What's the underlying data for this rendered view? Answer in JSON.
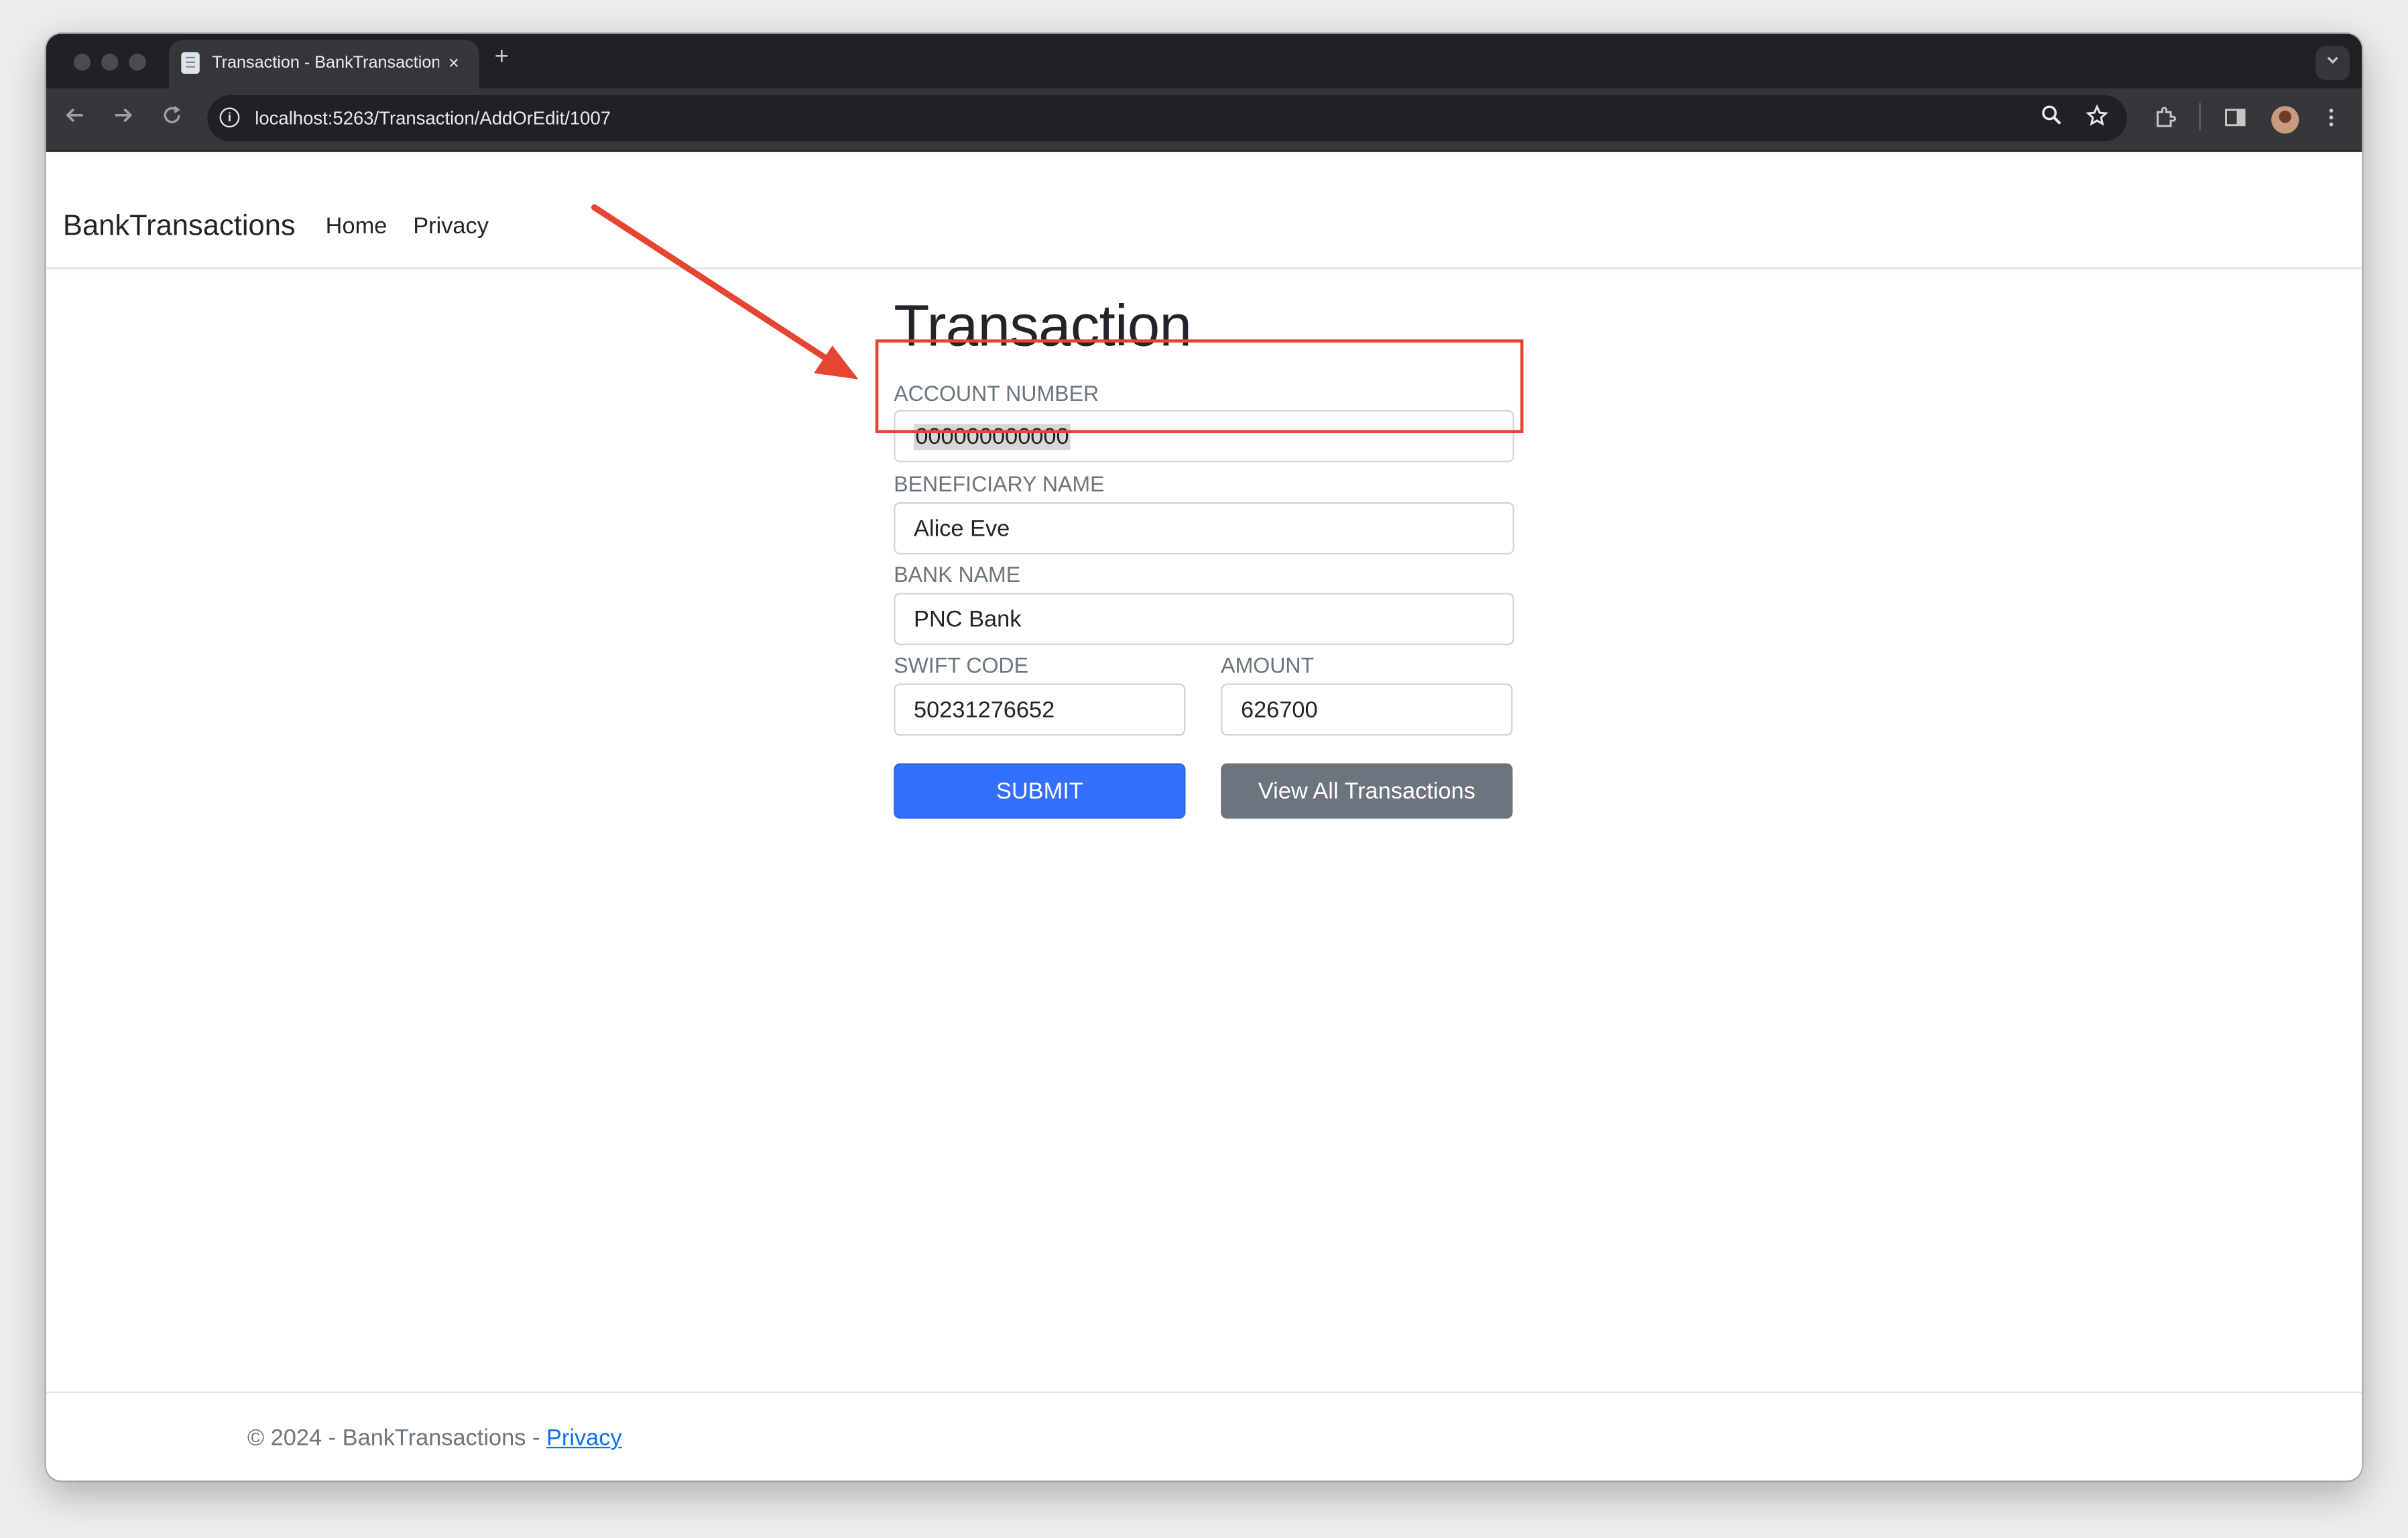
{
  "browser": {
    "tab_title": "Transaction - BankTransactions",
    "tab_close": "×",
    "new_tab": "+",
    "url": "localhost:5263/Transaction/AddOrEdit/1007"
  },
  "navbar": {
    "brand": "BankTransactions",
    "links": [
      "Home",
      "Privacy"
    ]
  },
  "form": {
    "title": "Transaction",
    "fields": {
      "account_number": {
        "label": "ACCOUNT NUMBER",
        "value": "000000000000"
      },
      "beneficiary_name": {
        "label": "BENEFICIARY NAME",
        "value": "Alice Eve"
      },
      "bank_name": {
        "label": "BANK NAME",
        "value": "PNC Bank"
      },
      "swift_code": {
        "label": "SWIFT CODE",
        "value": "50231276652"
      },
      "amount": {
        "label": "AMOUNT",
        "value": "626700"
      }
    },
    "submit_label": "SUBMIT",
    "view_all_label": "View All Transactions"
  },
  "footer": {
    "text": "© 2024 - BankTransactions - ",
    "link": "Privacy"
  },
  "annotation": {
    "color": "#e64532"
  },
  "colors": {
    "primary": "#3370fe",
    "secondary": "#6c757d"
  }
}
